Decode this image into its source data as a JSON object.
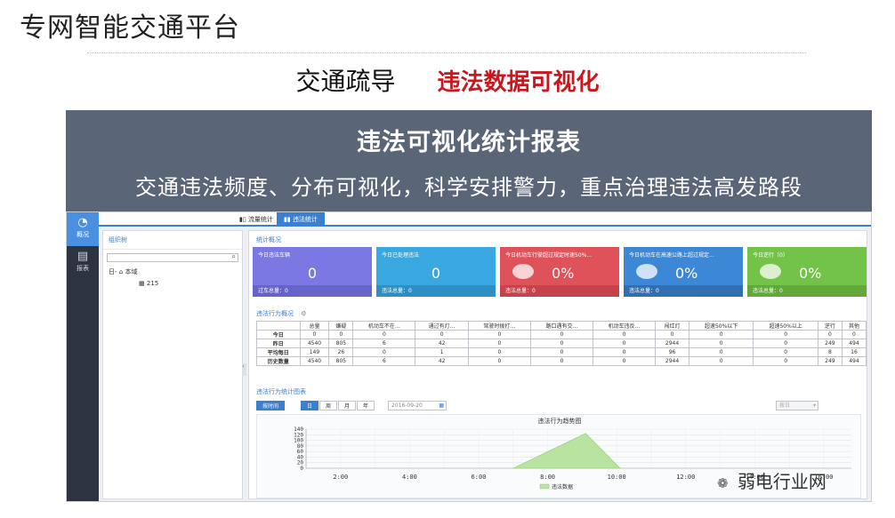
{
  "slide": {
    "title": "专网智能交通平台",
    "subtitle_left": "交通疏导",
    "subtitle_right": "违法数据可视化",
    "banner_title": "违法可视化统计报表",
    "banner_desc": "交通违法频度、分布可视化，科学安排警力，重点治理违法高发路段"
  },
  "app": {
    "nav": [
      {
        "icon": "pie-chart-icon",
        "label": "概况",
        "active": true
      },
      {
        "icon": "report-icon",
        "label": "报表",
        "active": false
      }
    ],
    "tabs": [
      {
        "label": "流量统计",
        "icon": "bar-icon"
      },
      {
        "label": "违法统计",
        "icon": "bar-icon",
        "active": true
      }
    ],
    "tree": {
      "header": "组织树",
      "root": "本域",
      "child": "215",
      "expander": "日-"
    },
    "overview_title": "统计概况",
    "cards": [
      {
        "title": "今日违法车辆",
        "value": "0",
        "footer": "过车总量：0",
        "color": "#7b78e3",
        "footer_color": "#6764c9"
      },
      {
        "title": "今日已处理违法",
        "value": "0",
        "footer": "违法总量：0",
        "color": "#3aa8e0",
        "footer_color": "#2e8fc4"
      },
      {
        "title": "今日机动车行驶超过规定时速50%...",
        "value": "0%",
        "footer": "违法总量：0",
        "color": "#e0525a",
        "footer_color": "#c7434b"
      },
      {
        "title": "今日机动车在高速公路上超过规定...",
        "value": "0%",
        "footer": "违法总量：0",
        "color": "#3c87d6",
        "footer_color": "#326fb1"
      },
      {
        "title": "今日逆行（0）",
        "value": "0%",
        "footer": "违法总量：0",
        "color": "#74c349",
        "footer_color": "#62a83b"
      }
    ],
    "behavior_title": "违法行为概况",
    "table": {
      "headers": [
        "",
        "总量",
        "嫌疑",
        "机动车不在…",
        "通过有灯…",
        "驾驶时拨打…",
        "路口遇有交…",
        "机动车违反…",
        "闯红灯",
        "超速50%以下",
        "超速50%以上",
        "逆行",
        "其他"
      ],
      "rows": [
        [
          "今日",
          "0",
          "0",
          "0",
          "0",
          "0",
          "0",
          "0",
          "0",
          "0",
          "0",
          "0",
          "0"
        ],
        [
          "昨日",
          "4540",
          "805",
          "6",
          "42",
          "0",
          "0",
          "0",
          "2944",
          "0",
          "0",
          "249",
          "494"
        ],
        [
          "平均每日",
          "149",
          "26",
          "0",
          "1",
          "0",
          "0",
          "0",
          "96",
          "0",
          "0",
          "8",
          "16"
        ],
        [
          "历史数量",
          "4540",
          "805",
          "6",
          "42",
          "0",
          "0",
          "0",
          "2944",
          "0",
          "0",
          "249",
          "494"
        ]
      ]
    },
    "trend_section_title": "违法行为统计图表",
    "controls": {
      "by_time": "按时间",
      "day": "日",
      "week": "周",
      "month": "月",
      "year": "年",
      "date": "2016-09-20",
      "select": "按日"
    }
  },
  "chart_data": {
    "type": "area",
    "title": "违法行为趋势图",
    "x": [
      "2:00",
      "4:00",
      "6:00",
      "8:00",
      "10:00",
      "12:00",
      "14:00",
      "16:00"
    ],
    "ylim": [
      0,
      140
    ],
    "yticks": [
      0,
      20,
      40,
      60,
      80,
      100,
      120,
      140
    ],
    "series": [
      {
        "name": "违法数据",
        "points": [
          [
            7,
            0
          ],
          [
            9.1,
            125
          ],
          [
            10.1,
            0
          ]
        ],
        "color": "#b9e3a0"
      }
    ],
    "grid": true,
    "legend": "bottom"
  },
  "watermark": "弱电行业网"
}
